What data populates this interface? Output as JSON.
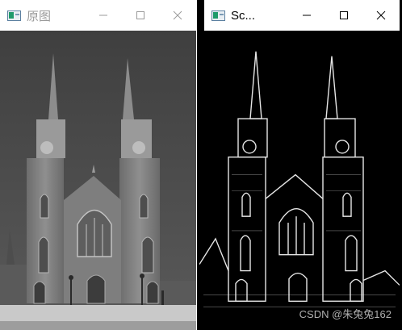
{
  "windows": {
    "original": {
      "title": "原图",
      "controls": {
        "minimize": "minimize",
        "maximize": "maximize",
        "close": "close"
      }
    },
    "result": {
      "title": "Sc...",
      "watermark": "CSDN @朱兔兔162",
      "controls": {
        "minimize": "minimize",
        "maximize": "maximize",
        "close": "close"
      }
    }
  },
  "colors": {
    "sky": "#4a4a4a",
    "stone": "#8a8a8a",
    "edge_background": "#000000",
    "edge_lines": "#ffffff"
  },
  "icons": [
    "app-icon",
    "minimize-icon",
    "maximize-icon",
    "close-icon"
  ]
}
